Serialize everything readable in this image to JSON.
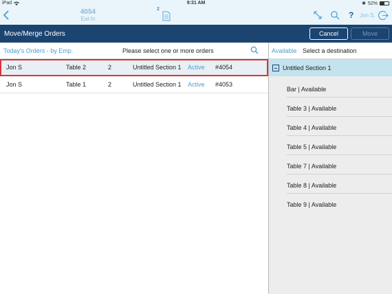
{
  "status_bar": {
    "device": "iPad",
    "time": "9:31 AM",
    "battery": "52%"
  },
  "top_bar": {
    "order_number": "4054",
    "order_type": "Eat In",
    "doc_badge": "2",
    "user": "Jon S."
  },
  "title_bar": {
    "title": "Move/Merge Orders",
    "cancel_label": "Cancel",
    "move_label": "Move"
  },
  "left_panel": {
    "filter_label": "Today's Orders - by Emp.",
    "instruction": "Please select one or more orders",
    "orders": [
      {
        "employee": "Jon S",
        "table": "Table 2",
        "guests": "2",
        "section": "Untitled Section 1",
        "status": "Active",
        "number": "#4054",
        "selected": true
      },
      {
        "employee": "Jon S",
        "table": "Table 1",
        "guests": "2",
        "section": "Untitled Section 1",
        "status": "Active",
        "number": "#4053",
        "selected": false
      }
    ]
  },
  "right_panel": {
    "available_label": "Available",
    "select_label": "Select a destination",
    "section_name": "Untitled Section 1",
    "destinations": [
      "Bar | Available",
      "Table 3 | Available",
      "Table 4 | Available",
      "Table 5 | Available",
      "Table 7 | Available",
      "Table 8 | Available",
      "Table 9 | Available"
    ]
  },
  "colors": {
    "title_bar_bg": "#1b4471",
    "accent_blue": "#4a9cd0",
    "selected_border": "#d9343a",
    "section_bg": "#c3e3ee"
  }
}
